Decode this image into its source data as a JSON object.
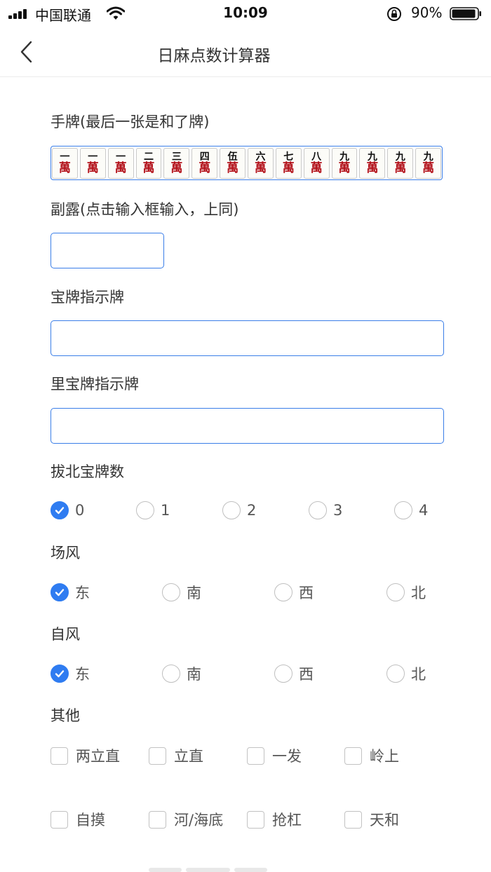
{
  "status_bar": {
    "carrier": "中国联通",
    "time": "10:09",
    "battery": "90%"
  },
  "nav": {
    "title": "日麻点数计算器"
  },
  "hand": {
    "label": "手牌(最后一张是和了牌)",
    "tiles": [
      {
        "num": "一",
        "suit": "萬"
      },
      {
        "num": "一",
        "suit": "萬"
      },
      {
        "num": "一",
        "suit": "萬"
      },
      {
        "num": "二",
        "suit": "萬"
      },
      {
        "num": "三",
        "suit": "萬"
      },
      {
        "num": "四",
        "suit": "萬"
      },
      {
        "num": "伍",
        "suit": "萬"
      },
      {
        "num": "六",
        "suit": "萬"
      },
      {
        "num": "七",
        "suit": "萬"
      },
      {
        "num": "八",
        "suit": "萬"
      },
      {
        "num": "九",
        "suit": "萬"
      },
      {
        "num": "九",
        "suit": "萬"
      },
      {
        "num": "九",
        "suit": "萬"
      },
      {
        "num": "九",
        "suit": "萬"
      }
    ]
  },
  "meld": {
    "label": "副露(点击输入框输入，上同)",
    "value": ""
  },
  "dora": {
    "label": "宝牌指示牌",
    "value": ""
  },
  "uradora": {
    "label": "里宝牌指示牌",
    "value": ""
  },
  "kita": {
    "label": "拔北宝牌数",
    "options": [
      "0",
      "1",
      "2",
      "3",
      "4"
    ],
    "selected": "0"
  },
  "round_wind": {
    "label": "场风",
    "options": [
      "东",
      "南",
      "西",
      "北"
    ],
    "selected": "东"
  },
  "seat_wind": {
    "label": "自风",
    "options": [
      "东",
      "南",
      "西",
      "北"
    ],
    "selected": "东"
  },
  "other": {
    "label": "其他",
    "row1": [
      "两立直",
      "立直",
      "一发",
      "岭上"
    ],
    "row2": [
      "自摸",
      "河/海底",
      "抢杠",
      "天和"
    ]
  },
  "colors": {
    "accent": "#2f7cf1",
    "border": "#3a7ee8",
    "tile_suit": "#b3121b"
  }
}
